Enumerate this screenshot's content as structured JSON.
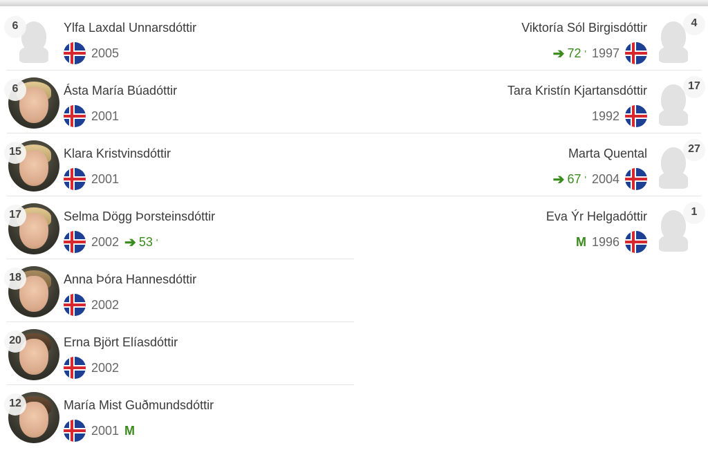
{
  "left_players": [
    {
      "number": "6",
      "name": "Ylfa Laxdal Unnarsdóttir",
      "year": "2005",
      "avatar": "ghost",
      "hair": "",
      "sub_minute": "",
      "motm": ""
    },
    {
      "number": "6",
      "name": "Ásta María Búadóttir",
      "year": "2001",
      "avatar": "photo",
      "hair": "light",
      "sub_minute": "",
      "motm": ""
    },
    {
      "number": "15",
      "name": "Klara Kristvinsdóttir",
      "year": "2001",
      "avatar": "photo",
      "hair": "light",
      "sub_minute": "",
      "motm": ""
    },
    {
      "number": "17",
      "name": "Selma Dögg Þorsteinsdóttir",
      "year": "2002",
      "avatar": "photo",
      "hair": "light",
      "sub_minute": "53",
      "motm": ""
    },
    {
      "number": "18",
      "name": "Anna Þóra Hannesdóttir",
      "year": "2002",
      "avatar": "photo",
      "hair": "mid",
      "sub_minute": "",
      "motm": ""
    },
    {
      "number": "20",
      "name": "Erna Björt Elíasdóttir",
      "year": "2002",
      "avatar": "photo",
      "hair": "dark",
      "sub_minute": "",
      "motm": ""
    },
    {
      "number": "12",
      "name": "María Mist Guðmundsdóttir",
      "year": "2001",
      "avatar": "photo",
      "hair": "dark",
      "sub_minute": "",
      "motm": "M"
    }
  ],
  "right_players": [
    {
      "number": "4",
      "name": "Viktoría Sól Birgisdóttir",
      "year": "1997",
      "avatar": "ghost",
      "sub_minute": "72",
      "motm": ""
    },
    {
      "number": "17",
      "name": "Tara Kristín Kjartansdóttir",
      "year": "1992",
      "avatar": "ghost",
      "sub_minute": "",
      "motm": ""
    },
    {
      "number": "27",
      "name": "Marta Quental",
      "year": "2004",
      "avatar": "ghost",
      "sub_minute": "67",
      "motm": ""
    },
    {
      "number": "1",
      "name": "Eva Ýr Helgadóttir",
      "year": "1996",
      "avatar": "ghost",
      "sub_minute": "",
      "motm": "M"
    }
  ],
  "minute_mark": "'",
  "icons": {
    "substitution": "arrow-right-icon",
    "flag": "iceland-flag-icon",
    "avatar_placeholder": "player-silhouette-icon"
  },
  "colors": {
    "green": "#3a8a1d",
    "flag_blue": "#1d3f94",
    "flag_red": "#d7282f"
  }
}
